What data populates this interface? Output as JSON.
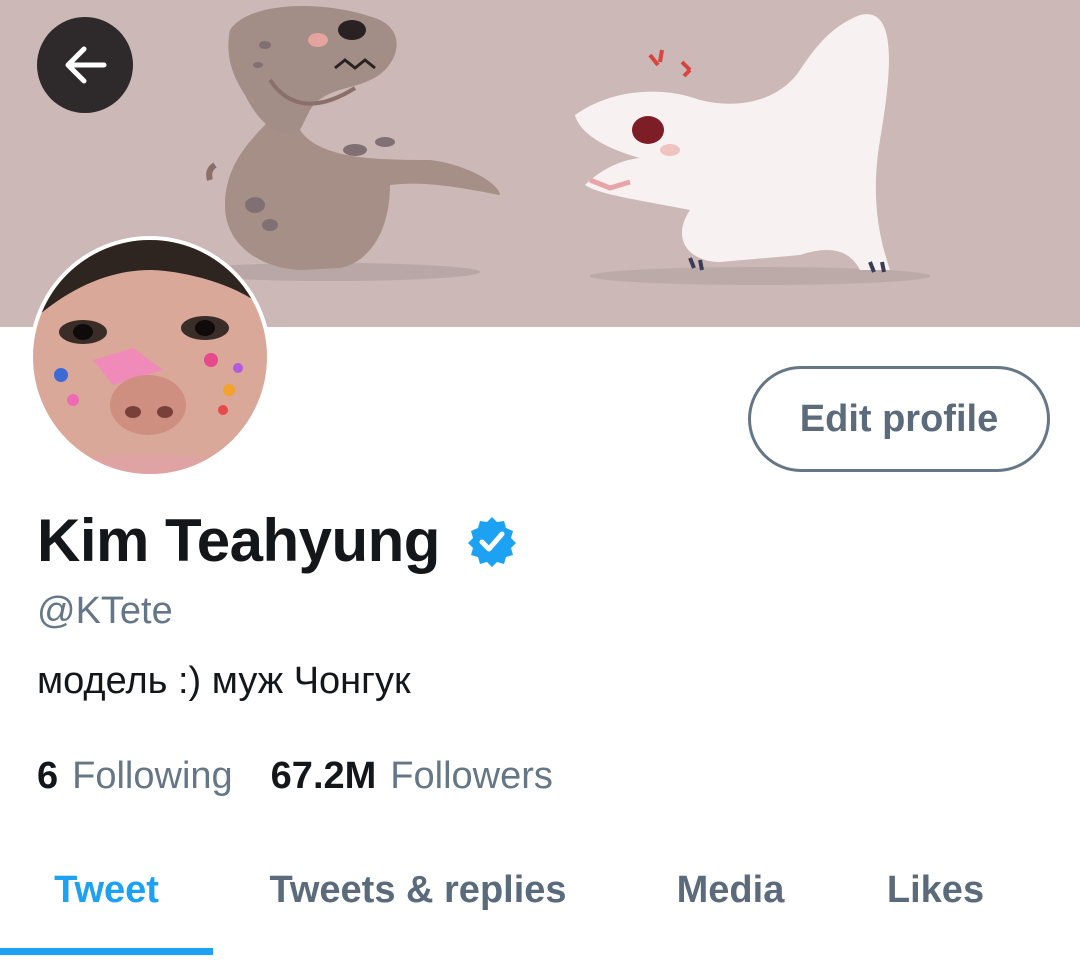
{
  "header": {
    "back_icon": "arrow-left-icon"
  },
  "profile": {
    "display_name": "Kim Teahyung",
    "verified_icon": "verified-badge-icon",
    "handle": "@KTete",
    "bio": "модель :) муж Чонгук",
    "edit_label": "Edit profile"
  },
  "stats": {
    "following_count": "6",
    "following_label": "Following",
    "followers_count": "67.2M",
    "followers_label": "Followers"
  },
  "tabs": [
    {
      "label": "Tweet",
      "active": true
    },
    {
      "label": "Tweets & replies",
      "active": false
    },
    {
      "label": "Media",
      "active": false
    },
    {
      "label": "Likes",
      "active": false
    }
  ],
  "colors": {
    "accent": "#1da1f2",
    "banner_bg": "#cbb8b7",
    "text_primary": "#14171a",
    "text_secondary": "#657786"
  }
}
